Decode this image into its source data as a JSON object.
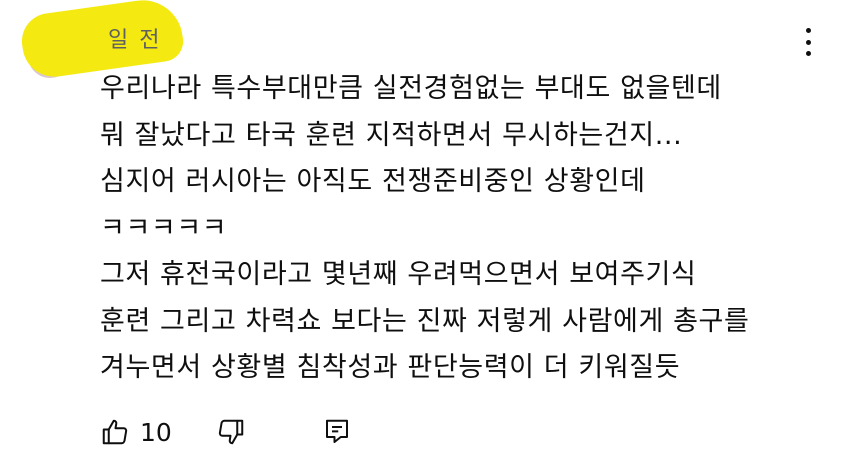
{
  "comment": {
    "author": "",
    "timestamp": "일 전",
    "lines": [
      "우리나라 특수부대만큼 실전경험없는 부대도 없을텐데",
      "뭐 잘났다고 타국 훈련 지적하면서 무시하는건지...",
      "심지어 러시아는 아직도 전쟁준비중인 상황인데",
      "ㅋㅋㅋㅋㅋ",
      "그저 휴전국이라고 몇년째 우려먹으면서 보여주기식",
      "훈련 그리고 차력쇼 보다는 진짜 저렇게 사람에게 총구를",
      "겨누면서 상황별 침착성과 판단능력이 더 키워질듯"
    ],
    "like_count": "10"
  },
  "icons": {
    "menu": "more-vert-icon",
    "like": "thumb-up-icon",
    "dislike": "thumb-down-icon",
    "reply": "reply-comment-icon"
  },
  "colors": {
    "highlight": "#f4ea12",
    "text": "#0f0f0f",
    "secondary": "#606060"
  }
}
